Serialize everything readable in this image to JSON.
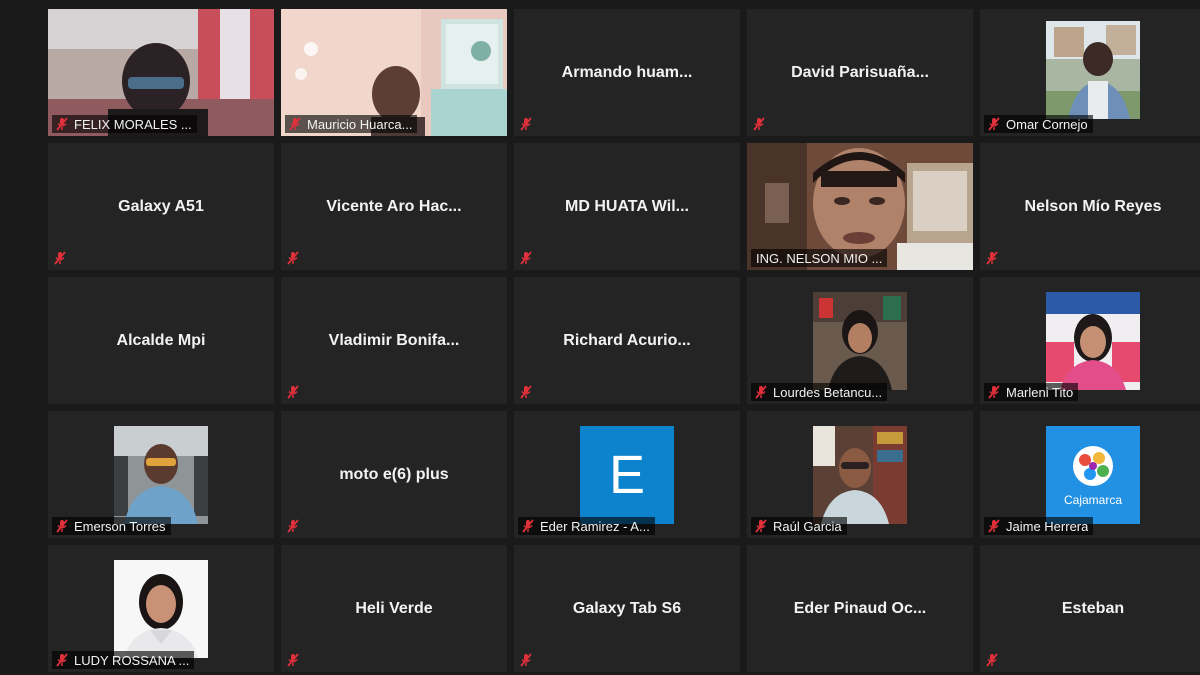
{
  "participants": [
    {
      "name": "FELIX MORALES ...",
      "kind": "video",
      "muted": true
    },
    {
      "name": "Mauricio Huarca...",
      "kind": "video",
      "muted": true
    },
    {
      "name": "Armando  huam...",
      "kind": "name",
      "muted": true
    },
    {
      "name": "David  Parisuaña...",
      "kind": "name",
      "muted": true
    },
    {
      "name": "Omar Cornejo",
      "kind": "photo",
      "muted": true
    },
    {
      "name": "Galaxy A51",
      "kind": "name",
      "muted": true
    },
    {
      "name": "Vicente  Aro  Hac...",
      "kind": "name",
      "muted": true
    },
    {
      "name": "MD  HUATA  Wil...",
      "kind": "name",
      "muted": true
    },
    {
      "name": "ING. NELSON MIO ...",
      "kind": "video",
      "muted": false,
      "speaking": true
    },
    {
      "name": "Nelson Mío Reyes",
      "kind": "name",
      "muted": true
    },
    {
      "name": "Alcalde Mpi",
      "kind": "name",
      "muted": false
    },
    {
      "name": "Vladimir  Bonifa...",
      "kind": "name",
      "muted": true
    },
    {
      "name": "Richard  Acurio...",
      "kind": "name",
      "muted": true
    },
    {
      "name": "Lourdes Betancu...",
      "kind": "photo",
      "muted": true
    },
    {
      "name": "Marleni Tito",
      "kind": "photo",
      "muted": true
    },
    {
      "name": "Emerson Torres",
      "kind": "photo",
      "muted": true
    },
    {
      "name": "moto e(6) plus",
      "kind": "name",
      "muted": true
    },
    {
      "name": "Eder Ramirez - A...",
      "kind": "letter",
      "letter": "E",
      "muted": true
    },
    {
      "name": "Raúl Garcia",
      "kind": "photo",
      "muted": true
    },
    {
      "name": "Jaime Herrera",
      "kind": "logo",
      "logo_text": "Cajamarca",
      "muted": true
    },
    {
      "name": "LUDY ROSSANA ...",
      "kind": "photo",
      "muted": true
    },
    {
      "name": "Heli Verde",
      "kind": "name",
      "muted": true
    },
    {
      "name": "Galaxy Tab S6",
      "kind": "name",
      "muted": true
    },
    {
      "name": "Eder  Pinaud  Oc...",
      "kind": "name",
      "muted": true
    },
    {
      "name": "Esteban",
      "kind": "name",
      "muted": true
    }
  ],
  "colors": {
    "background": "#1a1a1a",
    "tile": "#242424",
    "muted_icon": "#e0303a",
    "speaking_border": "#c8e36a",
    "letter_avatar": "#0e83cd"
  },
  "icons": {
    "mute": "muted-microphone-icon"
  }
}
